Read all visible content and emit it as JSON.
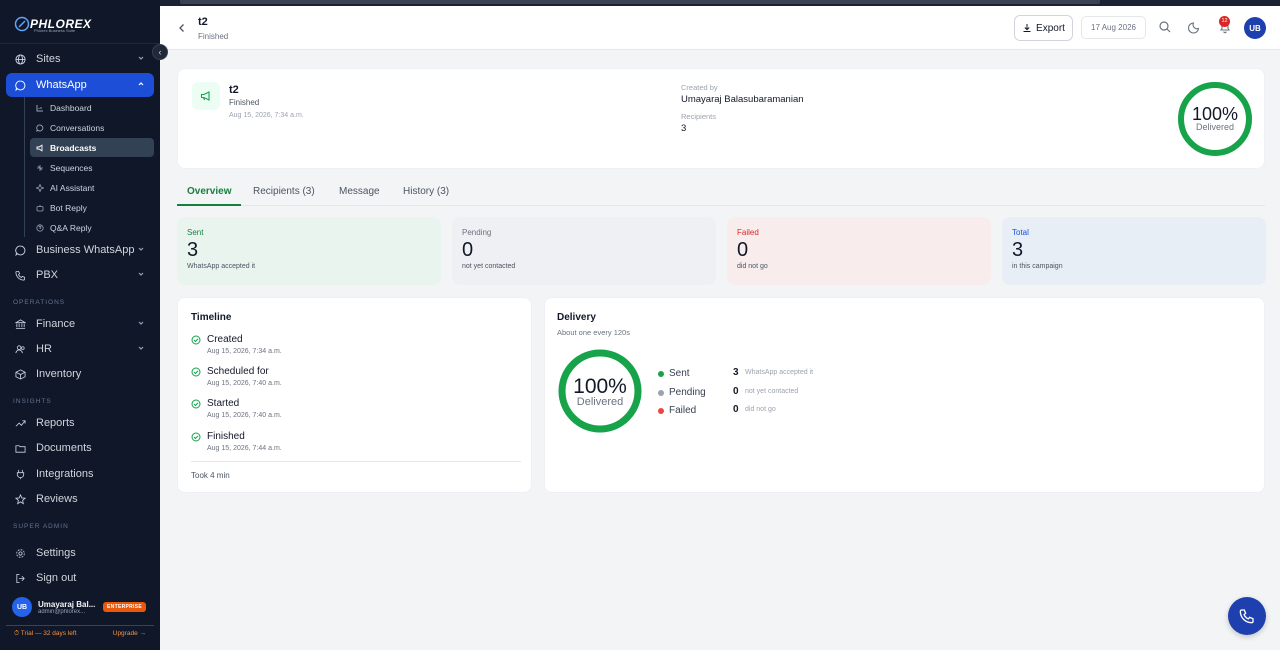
{
  "brand": {
    "logo_text": "PHLOREX",
    "tagline": "Phlorex Business Suite"
  },
  "sidebar": {
    "items": [
      {
        "label": "Sites",
        "icon": "globe-icon"
      },
      {
        "label": "WhatsApp",
        "icon": "chat-icon"
      }
    ],
    "whatsapp_sub": [
      {
        "label": "Dashboard",
        "icon": "chart-icon"
      },
      {
        "label": "Conversations",
        "icon": "chat-icon"
      },
      {
        "label": "Broadcasts",
        "icon": "megaphone-icon"
      },
      {
        "label": "Sequences",
        "icon": "sequence-icon"
      },
      {
        "label": "AI Assistant",
        "icon": "sparkle-icon"
      },
      {
        "label": "Bot Reply",
        "icon": "bot-icon"
      },
      {
        "label": "Q&A Reply",
        "icon": "qa-icon"
      }
    ],
    "more": [
      {
        "label": "Business WhatsApp",
        "icon": "chat-icon"
      },
      {
        "label": "PBX",
        "icon": "phone-icon"
      }
    ],
    "sections": {
      "operations": "OPERATIONS",
      "insights": "INSIGHTS",
      "super_admin": "SUPER ADMIN"
    },
    "operations": [
      {
        "label": "Finance",
        "icon": "bank-icon"
      },
      {
        "label": "HR",
        "icon": "people-icon"
      },
      {
        "label": "Inventory",
        "icon": "box-icon"
      }
    ],
    "insights": [
      {
        "label": "Reports",
        "icon": "trend-icon"
      },
      {
        "label": "Documents",
        "icon": "folder-icon"
      },
      {
        "label": "Integrations",
        "icon": "plug-icon"
      },
      {
        "label": "Reviews",
        "icon": "star-icon"
      }
    ],
    "admin": [
      {
        "label": "Settings",
        "icon": "gear-icon"
      },
      {
        "label": "Sign out",
        "icon": "signout-icon"
      }
    ],
    "user": {
      "initials": "UB",
      "name": "Umayaraj Bal...",
      "email": "admin@phlorex...",
      "plan": "ENTERPRISE"
    },
    "trial": {
      "text": "⏱ Trial — 32 days left",
      "upgrade": "Upgrade →"
    }
  },
  "header": {
    "title": "t2",
    "status": "Finished",
    "export_label": "Export",
    "date": "17 Aug 2026",
    "notifications": "12",
    "avatar_initials": "UB"
  },
  "summary": {
    "name": "t2",
    "status": "Finished",
    "date": "Aug 15, 2026, 7:34 a.m.",
    "created_by_label": "Created by",
    "created_by": "Umayaraj Balasubaramanian",
    "recipients_label": "Recipients",
    "recipients": "3",
    "delivered_pct": "100%",
    "delivered_label": "Delivered",
    "delivered_fraction": 1.0
  },
  "tabs": [
    {
      "label": "Overview",
      "active": true
    },
    {
      "label": "Recipients (3)",
      "active": false
    },
    {
      "label": "Message",
      "active": false
    },
    {
      "label": "History (3)",
      "active": false
    }
  ],
  "stats": [
    {
      "label": "Sent",
      "value": "3",
      "desc": "WhatsApp accepted it",
      "bg": "#eaf4ee",
      "color": "#15803d"
    },
    {
      "label": "Pending",
      "value": "0",
      "desc": "not yet contacted",
      "bg": "#eef0f4",
      "color": "#6b7280"
    },
    {
      "label": "Failed",
      "value": "0",
      "desc": "did not go",
      "bg": "#f8eced",
      "color": "#dc2626"
    },
    {
      "label": "Total",
      "value": "3",
      "desc": "in this campaign",
      "bg": "#e7eef6",
      "color": "#1d4ed8"
    }
  ],
  "timeline": {
    "title": "Timeline",
    "events": [
      {
        "title": "Created",
        "date": "Aug 15, 2026, 7:34 a.m."
      },
      {
        "title": "Scheduled for",
        "date": "Aug 15, 2026, 7:40 a.m."
      },
      {
        "title": "Started",
        "date": "Aug 15, 2026, 7:40 a.m."
      },
      {
        "title": "Finished",
        "date": "Aug 15, 2026, 7:44 a.m."
      }
    ],
    "duration": "Took 4 min"
  },
  "delivery": {
    "title": "Delivery",
    "subtitle": "About one every 120s",
    "pct": "100%",
    "pct_label": "Delivered",
    "fraction": 1.0,
    "rows": [
      {
        "name": "Sent",
        "value": "3",
        "note": "WhatsApp accepted it",
        "color": "#16a34a"
      },
      {
        "name": "Pending",
        "value": "0",
        "note": "not yet contacted",
        "color": "#9ca3af"
      },
      {
        "name": "Failed",
        "value": "0",
        "note": "did not go",
        "color": "#ef4444"
      }
    ]
  },
  "colors": {
    "accent": "#15803d",
    "brand": "#1d4ed8",
    "ring": "#16a34a"
  }
}
